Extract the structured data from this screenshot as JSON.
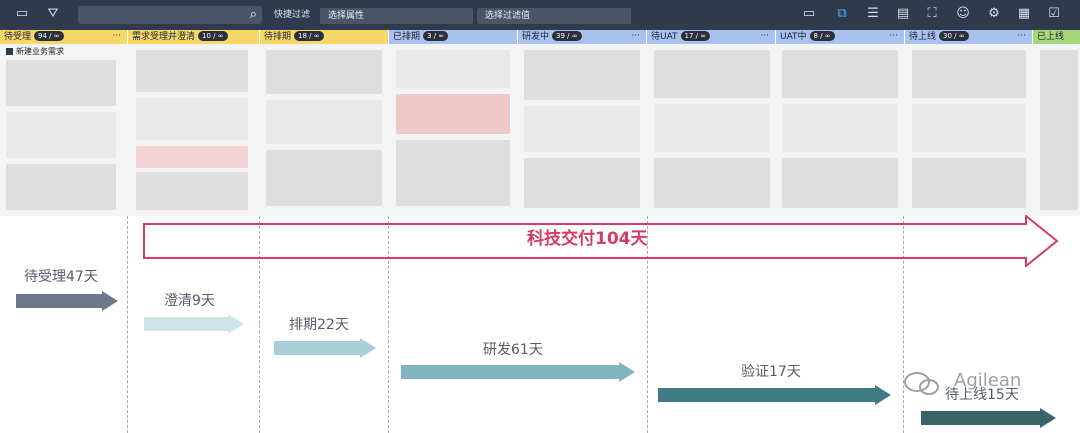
{
  "toolbar": {
    "quick_filter_label": "快捷过滤",
    "attribute_select": "选择属性",
    "filter_value_select": "选择过滤值"
  },
  "columns": [
    {
      "name": "待受理",
      "count": "94 / ∞",
      "color": "#f6d86a"
    },
    {
      "name": "需求受理并澄清",
      "count": "10 / ∞",
      "color": "#f6d86a"
    },
    {
      "name": "待排期",
      "count": "18 / ∞",
      "color": "#f6d86a"
    },
    {
      "name": "已排期",
      "count": "3 / ∞",
      "color": "#a9c1ee"
    },
    {
      "name": "研发中",
      "count": "39 / ∞",
      "color": "#a9c1ee"
    },
    {
      "name": "待UAT",
      "count": "17 / ∞",
      "color": "#a9c1ee"
    },
    {
      "name": "UAT中",
      "count": "8 / ∞",
      "color": "#a9c1ee"
    },
    {
      "name": "待上线",
      "count": "30 / ∞",
      "color": "#a9c1ee"
    },
    {
      "name": "已上线",
      "count": "",
      "color": "#a8d77a"
    }
  ],
  "column_more": "···",
  "board": {
    "swimlane_tag": "新建业务需求"
  },
  "timeline": {
    "total_label": "科技交付104天",
    "segments": [
      {
        "label": "待受理47天",
        "color": "#6e7789"
      },
      {
        "label": "澄清9天",
        "color": "#cfe4ea"
      },
      {
        "label": "排期22天",
        "color": "#a8ced6"
      },
      {
        "label": "研发61天",
        "color": "#7eb5c1"
      },
      {
        "label": "验证17天",
        "color": "#3f7b82"
      },
      {
        "label": "待上线15天",
        "color": "#3a6469"
      }
    ],
    "total_color": "#d63b62"
  },
  "watermark": "Agilean"
}
